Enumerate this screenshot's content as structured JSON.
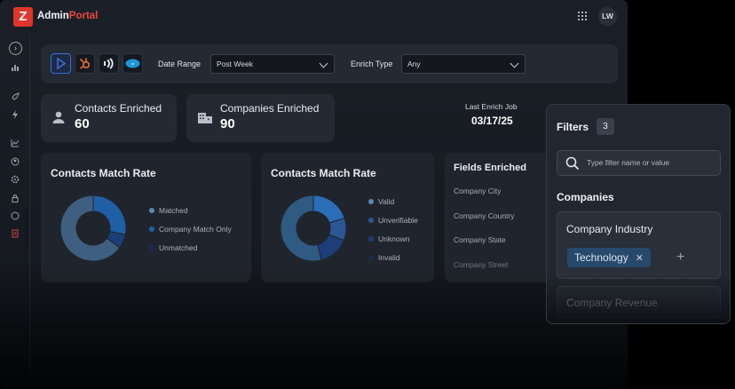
{
  "app": {
    "brand_main": "Admin",
    "brand_accent": "Portal",
    "user_initials": "LW",
    "logo_letter": "Z"
  },
  "toolbar": {
    "integrations": [
      "play-icon",
      "hubspot-icon",
      "signal-icon",
      "salesforce-icon"
    ],
    "date_range_label": "Date Range",
    "date_range_value": "Post Week",
    "enrich_type_label": "Enrich Type",
    "enrich_type_value": "Any"
  },
  "stats": {
    "contacts": {
      "title": "Contacts Enriched",
      "value": "60"
    },
    "companies": {
      "title": "Companies Enriched",
      "value": "90"
    },
    "last_job": {
      "label": "Last Enrich Job",
      "value": "03/17/25"
    }
  },
  "chart_data": [
    {
      "type": "pie",
      "title": "Contacts Match Rate",
      "categories": [
        "Matched",
        "Company Match Only",
        "Unmatched"
      ],
      "values": [
        28,
        7,
        65
      ],
      "colors": [
        "#1f5fa8",
        "#1a3f78",
        "#3e5f80"
      ]
    },
    {
      "type": "pie",
      "title": "Contacts Match Rate",
      "categories": [
        "Valid",
        "Unverifiable",
        "Unknown",
        "Invalid"
      ],
      "values": [
        20,
        11,
        15,
        54
      ],
      "colors": [
        "#2a6eb8",
        "#2b5796",
        "#1c3f7a",
        "#2f5a82"
      ]
    }
  ],
  "legend_colors": {
    "chart1": [
      "#5b87b3",
      "#1f5fa8",
      "#1a2c55"
    ],
    "chart2": [
      "#5b87b3",
      "#2b5796",
      "#1c3f7a",
      "#1c2a4f"
    ]
  },
  "fields": {
    "title": "Fields Enriched",
    "items": [
      "Company City",
      "Company Country",
      "Company State",
      "Company Street"
    ]
  },
  "filters": {
    "title": "Filters",
    "count": "3",
    "search_placeholder": "Type filter name or value",
    "section": "Companies",
    "groups": [
      {
        "title": "Company Industry",
        "chips": [
          "Technology"
        ]
      },
      {
        "title": "Company Revenue"
      }
    ]
  }
}
